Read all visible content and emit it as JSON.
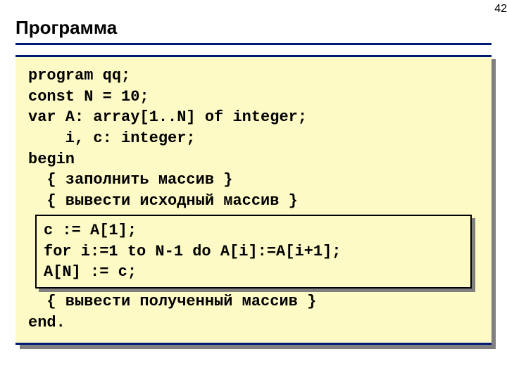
{
  "page_number": "42",
  "title": "Программа",
  "code": {
    "line1": "program qq;",
    "line2": "const N = 10;",
    "line3": "var A: array[1..N] of integer;",
    "line4": "    i, c: integer;",
    "line5": "begin",
    "line6": "  { заполнить массив }",
    "line7": "  { вывести исходный массив }",
    "inner_line1": "c := A[1];",
    "inner_line2": "for i:=1 to N-1 do A[i]:=A[i+1];",
    "inner_line3": "A[N] := c;",
    "line8": "  { вывести полученный массив }",
    "line9": "end."
  }
}
